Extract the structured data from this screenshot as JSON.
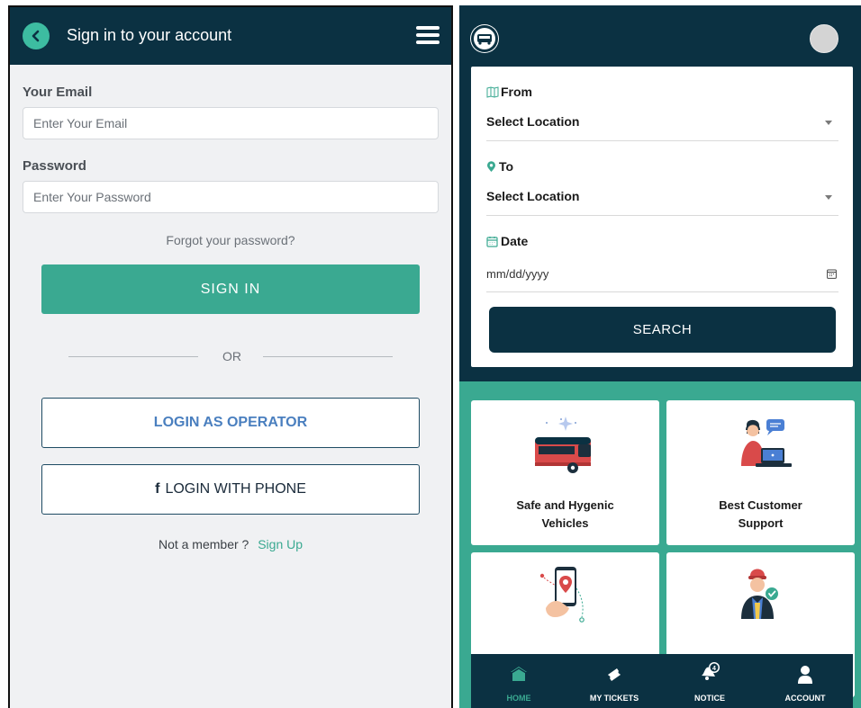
{
  "left": {
    "header_title": "Sign in to your account",
    "email_label": "Your Email",
    "email_placeholder": "Enter Your Email",
    "password_label": "Password",
    "password_placeholder": "Enter Your Password",
    "forgot": "Forgot your password?",
    "signin": "SIGN IN",
    "or": "OR",
    "operator": "LOGIN AS OPERATOR",
    "phone_icon": "f",
    "phone": "LOGIN WITH PHONE",
    "member": "Not a member ?",
    "signup": "Sign Up"
  },
  "right": {
    "from_label": "From",
    "from_value": "Select Location",
    "to_label": "To",
    "to_value": "Select Location",
    "date_label": "Date",
    "date_placeholder": "mm/dd/yyyy",
    "search": "SEARCH",
    "features": [
      {
        "line1": "Safe and Hygenic",
        "line2": "Vehicles"
      },
      {
        "line1": "Best Customer",
        "line2": "Support"
      }
    ],
    "nav": [
      {
        "label": "HOME"
      },
      {
        "label": "MY TICKETS"
      },
      {
        "label": "NOTICE",
        "badge": "4"
      },
      {
        "label": "ACCOUNT"
      }
    ]
  },
  "colors": {
    "navy": "#0b3142",
    "teal": "#3aa991",
    "operator_text": "#4a7fbf"
  },
  "icons": [
    "back-chevron-icon",
    "hamburger-menu-icon",
    "facebook-icon",
    "bus-logo-icon",
    "map-icon",
    "location-pin-icon",
    "calendar-icon",
    "home-icon",
    "ticket-icon",
    "bell-icon",
    "user-icon"
  ]
}
